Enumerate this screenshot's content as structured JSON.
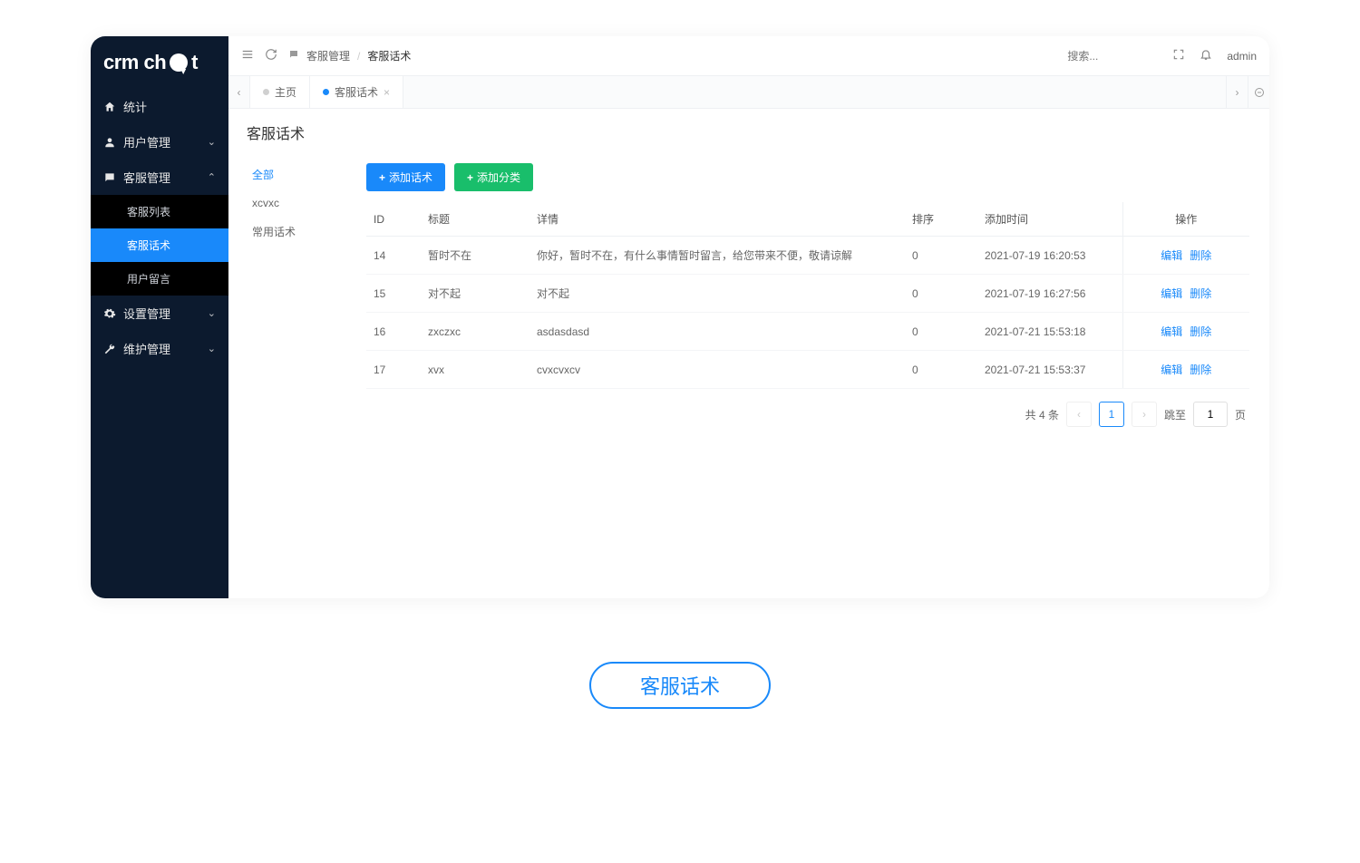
{
  "logo_text_left": "crm ch",
  "logo_text_right": "t",
  "sidebar": {
    "items": [
      {
        "label": "统计",
        "icon": "home",
        "expandable": false
      },
      {
        "label": "用户管理",
        "icon": "user",
        "expandable": true,
        "expanded": false
      },
      {
        "label": "客服管理",
        "icon": "chat",
        "expandable": true,
        "expanded": true
      },
      {
        "label": "设置管理",
        "icon": "gear",
        "expandable": true,
        "expanded": false
      },
      {
        "label": "维护管理",
        "icon": "wrench",
        "expandable": true,
        "expanded": false
      }
    ],
    "sub_items": [
      {
        "label": "客服列表"
      },
      {
        "label": "客服话术"
      },
      {
        "label": "用户留言"
      }
    ]
  },
  "breadcrumb": {
    "parent": "客服管理",
    "current": "客服话术"
  },
  "header": {
    "search_placeholder": "搜索...",
    "username": "admin"
  },
  "tabs": [
    {
      "label": "主页",
      "closable": false
    },
    {
      "label": "客服话术",
      "closable": true
    }
  ],
  "page_title": "客服话术",
  "categories": [
    {
      "label": "全部"
    },
    {
      "label": "xcvxc"
    },
    {
      "label": "常用话术"
    }
  ],
  "toolbar": {
    "add_script": "添加话术",
    "add_category": "添加分类"
  },
  "table": {
    "headers": {
      "id": "ID",
      "title": "标题",
      "detail": "详情",
      "sort": "排序",
      "time": "添加时间",
      "op": "操作"
    },
    "rows": [
      {
        "id": "14",
        "title": "暂时不在",
        "detail": "你好，暂时不在，有什么事情暂时留言，给您带来不便，敬请谅解",
        "sort": "0",
        "time": "2021-07-19 16:20:53"
      },
      {
        "id": "15",
        "title": "对不起",
        "detail": "对不起",
        "sort": "0",
        "time": "2021-07-19 16:27:56"
      },
      {
        "id": "16",
        "title": "zxczxc",
        "detail": "asdasdasd",
        "sort": "0",
        "time": "2021-07-21 15:53:18"
      },
      {
        "id": "17",
        "title": "xvx",
        "detail": "cvxcvxcv",
        "sort": "0",
        "time": "2021-07-21 15:53:37"
      }
    ],
    "edit_label": "编辑",
    "delete_label": "删除"
  },
  "pagination": {
    "total_label": "共 4 条",
    "current_page": "1",
    "jump_label_pre": "跳至",
    "jump_label_post": "页",
    "jump_value": "1"
  },
  "footer_pill_label": "客服话术"
}
